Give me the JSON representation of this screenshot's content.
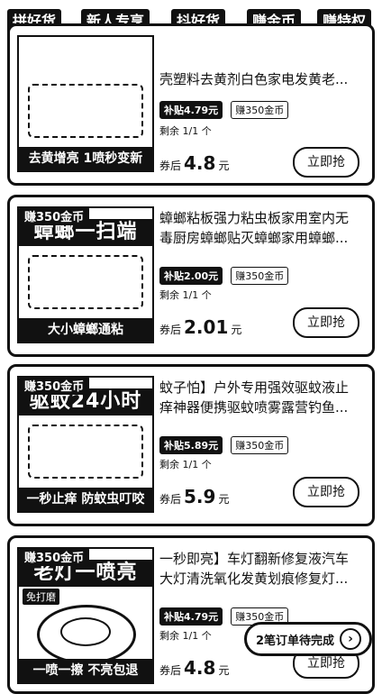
{
  "tabs": [
    "拼好货",
    "新人专享",
    "抖好货",
    "赚金币",
    "赚特权"
  ],
  "products": [
    {
      "coin_tag": "",
      "thumb_title": "",
      "thumb_strip": "去黄增亮 1喷秒变新",
      "name": "壳塑料去黄剂白色家电发黄老...",
      "subsidy": "补贴4.79元",
      "coin": "赚350金币",
      "stock": "剩余 1/1 个",
      "price_prefix": "券后",
      "price": "4.8",
      "price_unit": "元",
      "button": "立即抢"
    },
    {
      "coin_tag": "赚350金币",
      "thumb_title": "蟑螂一扫端",
      "thumb_strip": "大小蟑螂通粘",
      "name": "蟑螂粘板强力粘虫板家用室内无毒厨房蟑螂贴灭蟑螂家用蟑螂...",
      "subsidy": "补贴2.00元",
      "coin": "赚350金币",
      "stock": "剩余 1/1 个",
      "price_prefix": "券后",
      "price": "2.01",
      "price_unit": "元",
      "button": "立即抢"
    },
    {
      "coin_tag": "赚350金币",
      "thumb_title": "驱蚊24小时",
      "thumb_strip": "一秒止痒 防蚊虫叮咬",
      "name": "蚊子怕】户外专用强效驱蚊液止痒神器便携驱蚊喷雾露营钓鱼...",
      "subsidy": "补贴5.89元",
      "coin": "赚350金币",
      "stock": "剩余 1/1 个",
      "price_prefix": "券后",
      "price": "5.9",
      "price_unit": "元",
      "button": "立即抢"
    },
    {
      "coin_tag": "赚350金币",
      "thumb_title": "老灯一喷亮",
      "mini_tag": "免打磨",
      "thumb_strip": "一喷一擦 不亮包退",
      "name": "一秒即亮】车灯翻新修复液汽车大灯清洗氧化发黄划痕修复灯...",
      "subsidy": "补贴4.79元",
      "coin": "赚350金币",
      "stock": "剩余 1/1 个",
      "price_prefix": "券后",
      "price": "4.8",
      "price_unit": "元",
      "button": "立即抢"
    }
  ],
  "toast": {
    "text": "2笔订单待完成",
    "icon": "chevron-right-icon"
  }
}
